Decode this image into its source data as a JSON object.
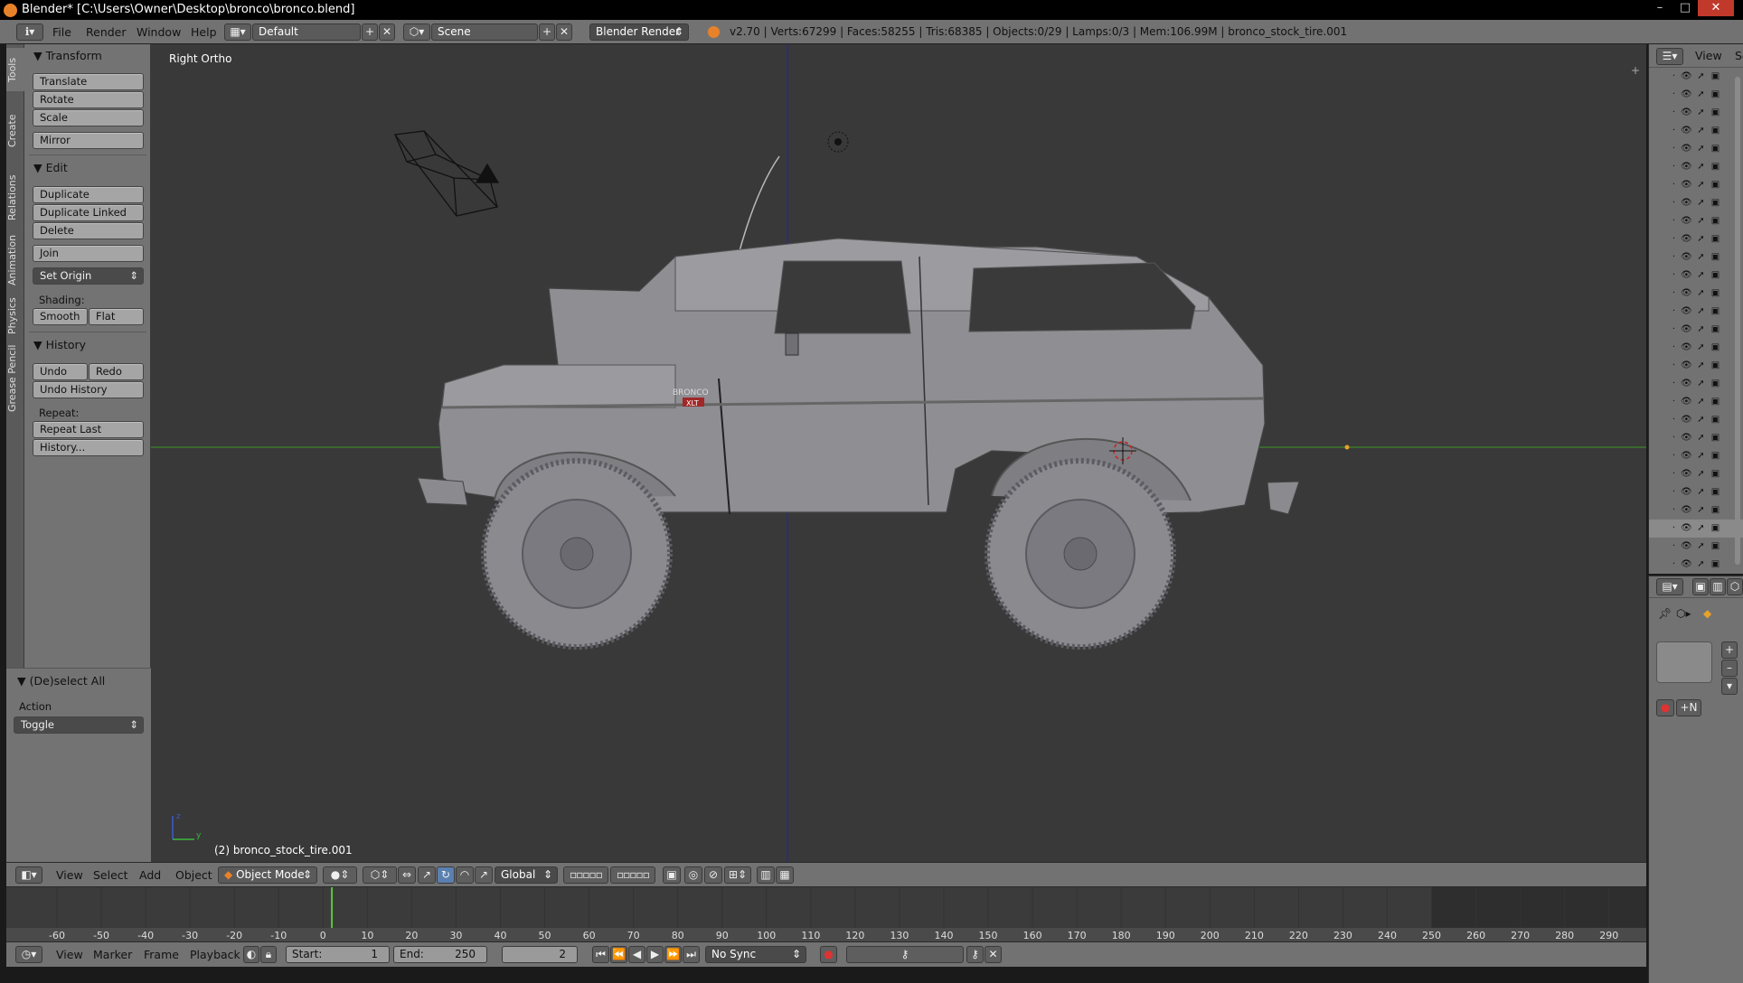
{
  "window": {
    "title": "Blender* [C:\\Users\\Owner\\Desktop\\bronco\\bronco.blend]",
    "buttons": [
      "–",
      "□",
      "✕"
    ]
  },
  "topbar": {
    "menus": [
      "File",
      "Render",
      "Window",
      "Help"
    ],
    "layout": "Default",
    "scene": "Scene",
    "render_engine": "Blender Render",
    "stats": "v2.70 | Verts:67299 | Faces:58255 | Tris:68385 | Objects:0/29 | Lamps:0/3 | Mem:106.99M | bronco_stock_tire.001"
  },
  "tabs": [
    "Tools",
    "Create",
    "Relations",
    "Animation",
    "Physics",
    "Grease Pencil"
  ],
  "toolshelf": {
    "transform": {
      "title": "Transform",
      "buttons": [
        "Translate",
        "Rotate",
        "Scale",
        "Mirror"
      ]
    },
    "edit": {
      "title": "Edit",
      "buttons": [
        "Duplicate",
        "Duplicate Linked",
        "Delete",
        "Join"
      ],
      "set_origin": "Set Origin",
      "shading_label": "Shading:",
      "smooth": "Smooth",
      "flat": "Flat"
    },
    "history": {
      "title": "History",
      "undo": "Undo",
      "redo": "Redo",
      "undo_history": "Undo History",
      "repeat_label": "Repeat:",
      "repeat_last": "Repeat Last",
      "history": "History..."
    }
  },
  "operator": {
    "title": "(De)select All",
    "action_label": "Action",
    "action_value": "Toggle"
  },
  "viewport": {
    "view_name": "Right Ortho",
    "object_label": "(2) bronco_stock_tire.001",
    "axis_z": "z",
    "axis_y": "y",
    "badge_brand": "BRONCO",
    "badge_trim": "XLT"
  },
  "view_header": {
    "menus": [
      "View",
      "Select",
      "Add",
      "Object"
    ],
    "mode": "Object Mode",
    "orientation": "Global"
  },
  "timeline": {
    "ticks": [
      "-60",
      "-50",
      "-40",
      "-30",
      "-20",
      "-10",
      "0",
      "10",
      "20",
      "30",
      "40",
      "50",
      "60",
      "70",
      "80",
      "90",
      "100",
      "110",
      "120",
      "130",
      "140",
      "150",
      "160",
      "170",
      "180",
      "190",
      "200",
      "210",
      "220",
      "230",
      "240",
      "250",
      "260",
      "270",
      "280",
      "290"
    ],
    "current_frame_value": 2,
    "end_frame_value": 250
  },
  "timeline_header": {
    "menus": [
      "View",
      "Marker",
      "Frame",
      "Playback"
    ],
    "start_label": "Start:",
    "start_value": "1",
    "end_label": "End:",
    "end_value": "250",
    "current": "2",
    "sync": "No Sync"
  },
  "outliner": {
    "header_view": "View",
    "header_search": "Se"
  },
  "colors": {
    "accent_orange": "#e8822a",
    "current_frame": "#5cc83a",
    "axis_green": "#3a7a2a",
    "axis_blue": "#2a2a80"
  }
}
